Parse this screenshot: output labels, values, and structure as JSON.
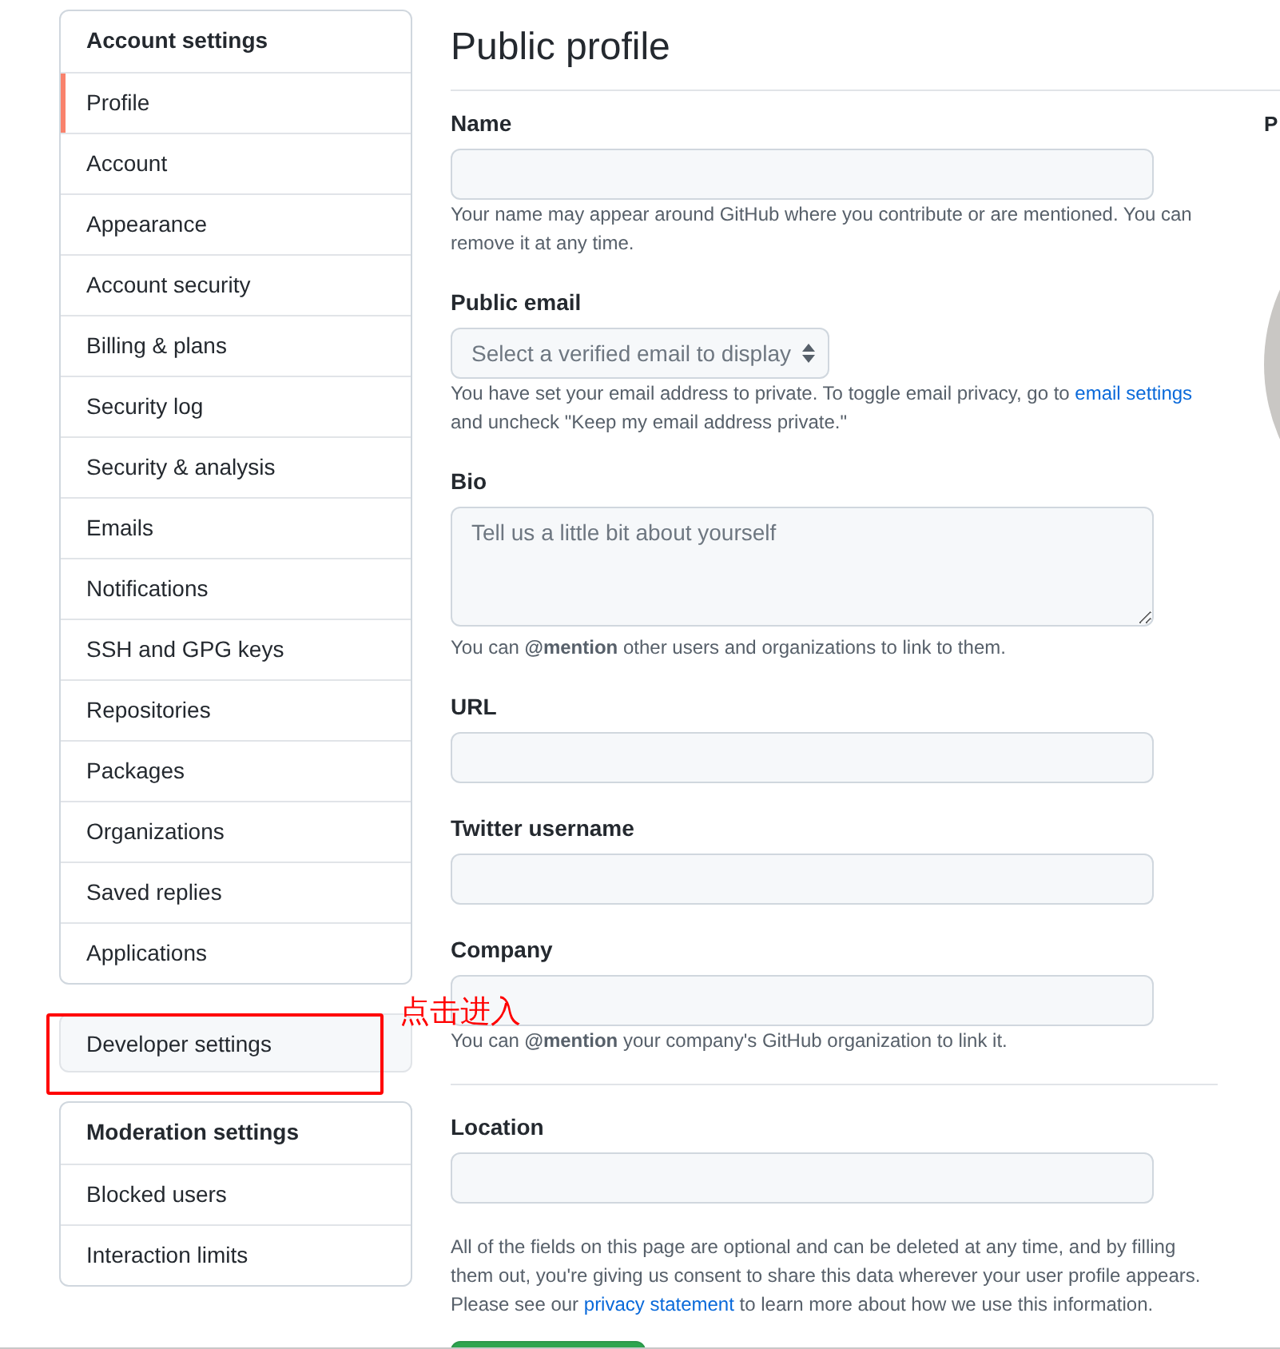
{
  "sidebar": {
    "header": "Account settings",
    "items": [
      {
        "label": "Profile",
        "selected": true
      },
      {
        "label": "Account",
        "selected": false
      },
      {
        "label": "Appearance",
        "selected": false
      },
      {
        "label": "Account security",
        "selected": false
      },
      {
        "label": "Billing & plans",
        "selected": false
      },
      {
        "label": "Security log",
        "selected": false
      },
      {
        "label": "Security & analysis",
        "selected": false
      },
      {
        "label": "Emails",
        "selected": false
      },
      {
        "label": "Notifications",
        "selected": false
      },
      {
        "label": "SSH and GPG keys",
        "selected": false
      },
      {
        "label": "Repositories",
        "selected": false
      },
      {
        "label": "Packages",
        "selected": false
      },
      {
        "label": "Organizations",
        "selected": false
      },
      {
        "label": "Saved replies",
        "selected": false
      },
      {
        "label": "Applications",
        "selected": false
      }
    ]
  },
  "developer_item": {
    "label": "Developer settings"
  },
  "annotation": {
    "text": "点击进入",
    "color": "#ff0000"
  },
  "moderation": {
    "header": "Moderation settings",
    "items": [
      {
        "label": "Blocked users",
        "selected": false
      },
      {
        "label": "Interaction limits",
        "selected": false
      }
    ]
  },
  "main": {
    "title": "Public profile",
    "fields": [
      {
        "kind": "input",
        "label": "Name",
        "note": [
          {
            "kind": "text",
            "text": "Your name may appear around GitHub where you contribute or are mentioned. You can remove it at any time."
          }
        ]
      },
      {
        "kind": "select",
        "label": "Public email",
        "placeholder": "Select a verified email to display",
        "note": [
          {
            "kind": "text",
            "text": "You have set your email address to private. To toggle email privacy, go to "
          },
          {
            "kind": "link",
            "text": "email settings"
          },
          {
            "kind": "text",
            "text": " and uncheck \"Keep my email address private.\""
          }
        ]
      },
      {
        "kind": "textarea",
        "label": "Bio",
        "placeholder": "Tell us a little bit about yourself",
        "note": [
          {
            "kind": "text",
            "text": "You can **@mention** other users and organizations to link to them."
          }
        ]
      },
      {
        "kind": "input",
        "label": "URL"
      },
      {
        "kind": "input",
        "label": "Twitter username"
      },
      {
        "kind": "input",
        "label": "Company",
        "note": [
          {
            "kind": "text",
            "text": "You can **@mention** your company's GitHub organization to link it."
          }
        ]
      },
      {
        "kind": "divider"
      },
      {
        "kind": "input",
        "label": "Location"
      }
    ],
    "footer_note": [
      {
        "kind": "text",
        "text": "All of the fields on this page are optional and can be deleted at any time, and by filling them out, you're giving us consent to share this data wherever your user profile appears. Please see our "
      },
      {
        "kind": "link",
        "text": "privacy statement"
      },
      {
        "kind": "text",
        "text": " to learn more about how we use this information."
      }
    ]
  },
  "aside": {
    "heading": "P"
  }
}
